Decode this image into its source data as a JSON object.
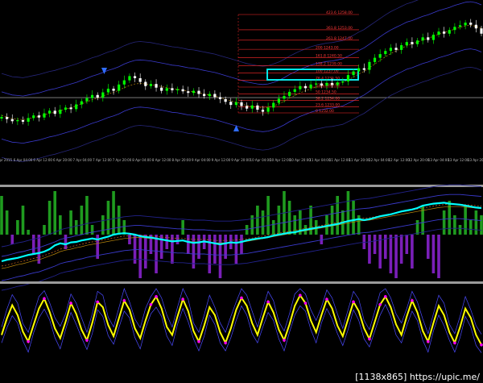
{
  "chart_data": {
    "type": "line",
    "panels": [
      {
        "name": "price",
        "series": [
          {
            "values": [
              1236.6,
              1236.2,
              1235.8,
              1236.0,
              1235.7,
              1236.4,
              1236.9,
              1236.5,
              1237.3,
              1237.8,
              1237.2,
              1238.0,
              1238.4,
              1238.1,
              1239.0,
              1239.6,
              1240.2,
              1240.8,
              1240.3,
              1241.3,
              1242.0,
              1241.6,
              1242.8,
              1243.6,
              1244.4,
              1244.0,
              1243.3,
              1242.5,
              1242.9,
              1242.2,
              1241.6,
              1242.1,
              1241.7,
              1241.9,
              1241.5,
              1241.2,
              1241.6,
              1241.0,
              1240.6,
              1241.0,
              1240.4,
              1240.0,
              1239.5,
              1238.9,
              1239.4,
              1238.7,
              1238.2,
              1238.8,
              1238.0,
              1237.6,
              1238.4,
              1239.3,
              1240.1,
              1240.6,
              1241.4,
              1241.9,
              1242.5,
              1242.1,
              1242.8,
              1243.0,
              1242.6,
              1243.1,
              1242.7,
              1243.2,
              1243.4,
              1244.6,
              1245.3,
              1245.9,
              1245.6,
              1247.1,
              1247.9,
              1248.6,
              1249.2,
              1249.8,
              1249.4,
              1250.3,
              1250.9,
              1250.5,
              1251.2,
              1251.8,
              1251.3,
              1252.3,
              1252.9,
              1252.5,
              1253.2,
              1253.8,
              1254.1,
              1254.6,
              1254.2,
              1253.5,
              1252.5
            ]
          },
          {
            "values": [
              1236.9,
              1236.6,
              1236.3,
              1236.2,
              1236.1,
              1236.3,
              1236.5,
              1236.7,
              1237.0,
              1237.3,
              1237.5,
              1237.8,
              1238.1,
              1238.4,
              1238.7,
              1239.1,
              1239.5,
              1239.9,
              1240.2,
              1240.6,
              1241.0,
              1241.3,
              1241.7,
              1242.2,
              1242.6,
              1242.9,
              1243.0,
              1242.9,
              1242.8,
              1242.6,
              1242.4,
              1242.2,
              1242.0,
              1241.9,
              1241.7,
              1241.5,
              1241.4,
              1241.2,
              1241.0,
              1240.8,
              1240.6,
              1240.3,
              1240.0,
              1239.7,
              1239.4,
              1239.1,
              1238.8,
              1238.6,
              1238.4,
              1238.3,
              1238.4,
              1238.7,
              1239.1,
              1239.6,
              1240.2,
              1240.7,
              1241.2,
              1241.6,
              1242.0,
              1242.3,
              1242.5,
              1242.7,
              1242.8,
              1243.0,
              1243.2,
              1243.7,
              1244.2,
              1244.8,
              1245.3,
              1246.0,
              1246.7,
              1247.4,
              1248.1,
              1248.7,
              1249.2,
              1249.7,
              1250.2,
              1250.5,
              1250.9,
              1251.3,
              1251.6,
              1252.0,
              1252.4,
              1252.7,
              1253.0,
              1253.4,
              1253.7,
              1254.0,
              1254.1,
              1253.9,
              1253.5
            ]
          }
        ],
        "levels": [
          1240.3
        ]
      },
      {
        "name": "oscillator",
        "histogram": [
          0.8,
          0.5,
          -0.2,
          0.3,
          0.6,
          0.1,
          -0.4,
          -0.6,
          0.2,
          0.7,
          0.9,
          0.4,
          -0.3,
          0.5,
          0.3,
          0.6,
          0.8,
          0.2,
          -0.5,
          0.4,
          0.7,
          0.9,
          0.6,
          0.3,
          -0.2,
          -0.6,
          -0.9,
          -0.7,
          -0.4,
          -0.8,
          -0.5,
          -0.3,
          -0.6,
          -0.2,
          0.3,
          -0.4,
          -0.7,
          -0.5,
          -0.3,
          -0.8,
          -0.6,
          -0.9,
          -0.5,
          -0.3,
          -0.6,
          -0.4,
          0.2,
          0.4,
          0.6,
          0.5,
          0.8,
          0.3,
          0.6,
          0.9,
          0.7,
          0.4,
          0.5,
          0.2,
          0.6,
          0.3,
          -0.2,
          0.4,
          0.6,
          0.8,
          0.5,
          0.9,
          0.7,
          0.4,
          -0.3,
          -0.6,
          -0.4,
          -0.7,
          -0.5,
          -0.8,
          -0.9,
          -0.6,
          -0.4,
          -0.7,
          0.3,
          0.6,
          -0.5,
          -0.8,
          -0.9,
          0.5,
          0.7,
          0.4,
          0.2,
          0.6,
          0.3,
          0.5,
          0.4
        ],
        "series": [
          {
            "values": [
              -0.55,
              -0.52,
              -0.5,
              -0.48,
              -0.45,
              -0.42,
              -0.4,
              -0.38,
              -0.35,
              -0.3,
              -0.22,
              -0.18,
              -0.2,
              -0.16,
              -0.15,
              -0.12,
              -0.1,
              -0.08,
              -0.1,
              -0.07,
              -0.04,
              0.0,
              0.02,
              0.03,
              0.02,
              0.0,
              -0.03,
              -0.05,
              -0.06,
              -0.08,
              -0.1,
              -0.12,
              -0.14,
              -0.13,
              -0.12,
              -0.15,
              -0.17,
              -0.16,
              -0.14,
              -0.16,
              -0.18,
              -0.2,
              -0.18,
              -0.16,
              -0.17,
              -0.15,
              -0.12,
              -0.1,
              -0.08,
              -0.07,
              -0.05,
              -0.02,
              0.0,
              0.02,
              0.04,
              0.05,
              0.08,
              0.1,
              0.12,
              0.14,
              0.16,
              0.18,
              0.2,
              0.22,
              0.25,
              0.28,
              0.3,
              0.32,
              0.3,
              0.32,
              0.35,
              0.38,
              0.4,
              0.42,
              0.45,
              0.48,
              0.5,
              0.52,
              0.55,
              0.6,
              0.62,
              0.64,
              0.65,
              0.66,
              0.64,
              0.63,
              0.62,
              0.6,
              0.58,
              0.56,
              0.55
            ]
          },
          {
            "values": [
              -0.7,
              -0.68,
              -0.65,
              -0.62,
              -0.6,
              -0.57,
              -0.54,
              -0.52,
              -0.48,
              -0.44,
              -0.4,
              -0.35,
              -0.32,
              -0.3,
              -0.27,
              -0.25,
              -0.22,
              -0.2,
              -0.18,
              -0.16,
              -0.14,
              -0.12,
              -0.1,
              -0.08,
              -0.07,
              -0.06,
              -0.06,
              -0.07,
              -0.08,
              -0.09,
              -0.1,
              -0.11,
              -0.12,
              -0.13,
              -0.13,
              -0.14,
              -0.15,
              -0.15,
              -0.15,
              -0.16,
              -0.17,
              -0.17,
              -0.17,
              -0.17,
              -0.16,
              -0.15,
              -0.14,
              -0.12,
              -0.1,
              -0.08,
              -0.06,
              -0.04,
              -0.02,
              0.0,
              0.02,
              0.04,
              0.06,
              0.08,
              0.1,
              0.12,
              0.14,
              0.16,
              0.18,
              0.2,
              0.22,
              0.24,
              0.26,
              0.28,
              0.29,
              0.3,
              0.32,
              0.34,
              0.36,
              0.38,
              0.4,
              0.42,
              0.44,
              0.46,
              0.48,
              0.5,
              0.52,
              0.54,
              0.56,
              0.57,
              0.58,
              0.58,
              0.58,
              0.57,
              0.56,
              0.55,
              0.54
            ]
          }
        ]
      },
      {
        "name": "stochastic",
        "ylim": [
          0,
          100
        ],
        "series": [
          {
            "values": [
              30,
              55,
              75,
              60,
              35,
              20,
              45,
              70,
              85,
              65,
              40,
              25,
              50,
              78,
              62,
              38,
              22,
              48,
              80,
              72,
              45,
              28,
              55,
              82,
              68,
              40,
              25,
              52,
              76,
              88,
              70,
              42,
              30,
              58,
              84,
              66,
              36,
              20,
              44,
              72,
              60,
              34,
              18,
              40,
              68,
              86,
              74,
              48,
              30,
              56,
              80,
              64,
              38,
              22,
              46,
              74,
              90,
              78,
              52,
              34,
              60,
              84,
              70,
              44,
              28,
              54,
              80,
              66,
              40,
              24,
              50,
              76,
              88,
              72,
              46,
              30,
              58,
              82,
              64,
              36,
              20,
              48,
              74,
              60,
              34,
              18,
              42,
              70,
              56,
              30,
              15
            ]
          }
        ]
      }
    ],
    "annotations": [
      {
        "type": "fibonacci",
        "levels": [
          "423.6 1258.00",
          "361.8 1253.00",
          "261.8 1247.00",
          "200 1243.00",
          "161.8 1240.50",
          "138.2 1239.00",
          "100 1237.00",
          "76.4 1235.50",
          "61.8 1235.00",
          "50 1234.50",
          "38.2 1234.00",
          "23.6 1233.00",
          "0 1232.00"
        ]
      }
    ],
    "x_tick_labels": [
      "6 Apr 2015",
      "6 Apr 04:00",
      "6 Apr 12:00",
      "6 Apr 20:00",
      "7 Apr 04:00",
      "7 Apr 12:00",
      "7 Apr 20:00",
      "8 Apr 04:00",
      "8 Apr 12:00",
      "8 Apr 20:00",
      "9 Apr 04:00",
      "9 Apr 12:00",
      "9 Apr 20:00",
      "10 Apr 04:00",
      "10 Apr 12:00",
      "10 Apr 20:00",
      "11 Apr 04:00",
      "11 Apr 12:00",
      "11 Apr 20:00",
      "12 Apr 04:00",
      "12 Apr 12:00",
      "12 Apr 20:00",
      "13 Apr 04:00",
      "13 Apr 12:00",
      "13 Apr 20:00"
    ],
    "xlabel": "",
    "ylabel": ""
  },
  "watermark": "[1138x865] https://upic.me/",
  "colors": {
    "background": "#000000",
    "bull": "#00ff00",
    "bear": "#ffffff",
    "cyan": "#00ffff",
    "fib": "#ff2a2a",
    "purple": "#9b30ff",
    "yellow": "#ffff00",
    "magenta": "#ff00ff",
    "blue": "#3344ff",
    "divider": "#9a9a9a",
    "hline": "#8c8c8c"
  }
}
